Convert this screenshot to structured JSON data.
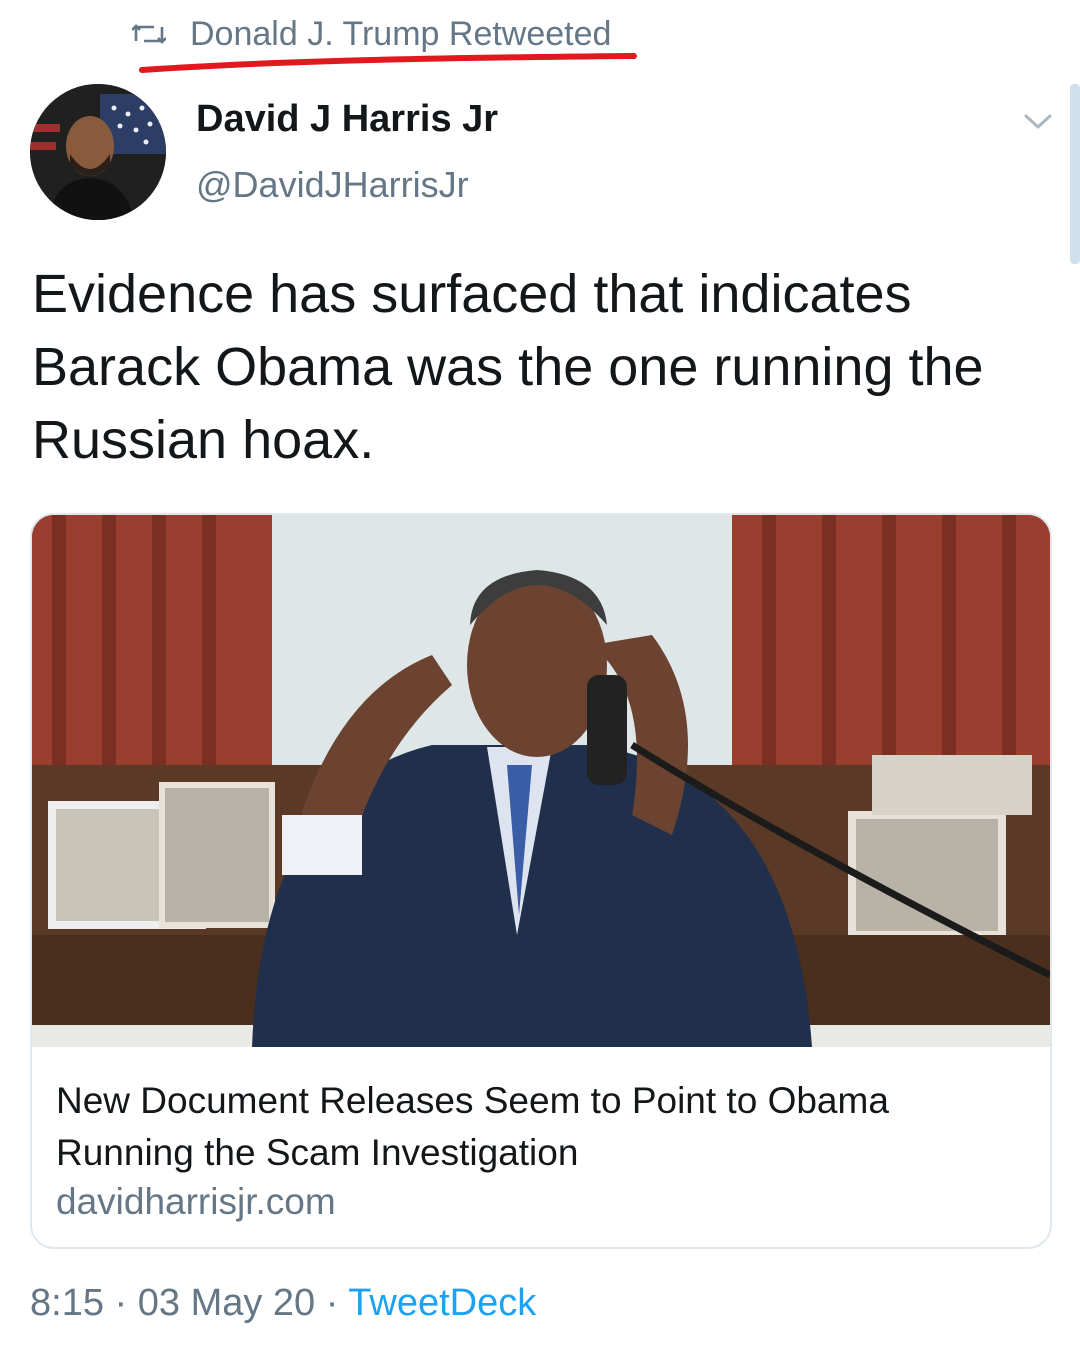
{
  "retweet": {
    "label": "Donald J. Trump Retweeted",
    "icon": "retweet-icon"
  },
  "author": {
    "name": "David J Harris Jr",
    "handle": "@DavidJHarrisJr"
  },
  "tweet": {
    "text": "Evidence has surfaced that indicates Barack Obama was the one running the Russian hoax."
  },
  "card": {
    "title": "New Document Releases Seem to Point to Obama Running the Scam Investigation",
    "domain": "davidharrisjr.com"
  },
  "meta": {
    "time": "8:15",
    "date": "03 May 20",
    "separator": " · ",
    "source": "TweetDeck"
  },
  "colors": {
    "text": "#14171a",
    "secondary": "#657786",
    "link": "#1da1f2",
    "annotation": "#e0191f"
  }
}
